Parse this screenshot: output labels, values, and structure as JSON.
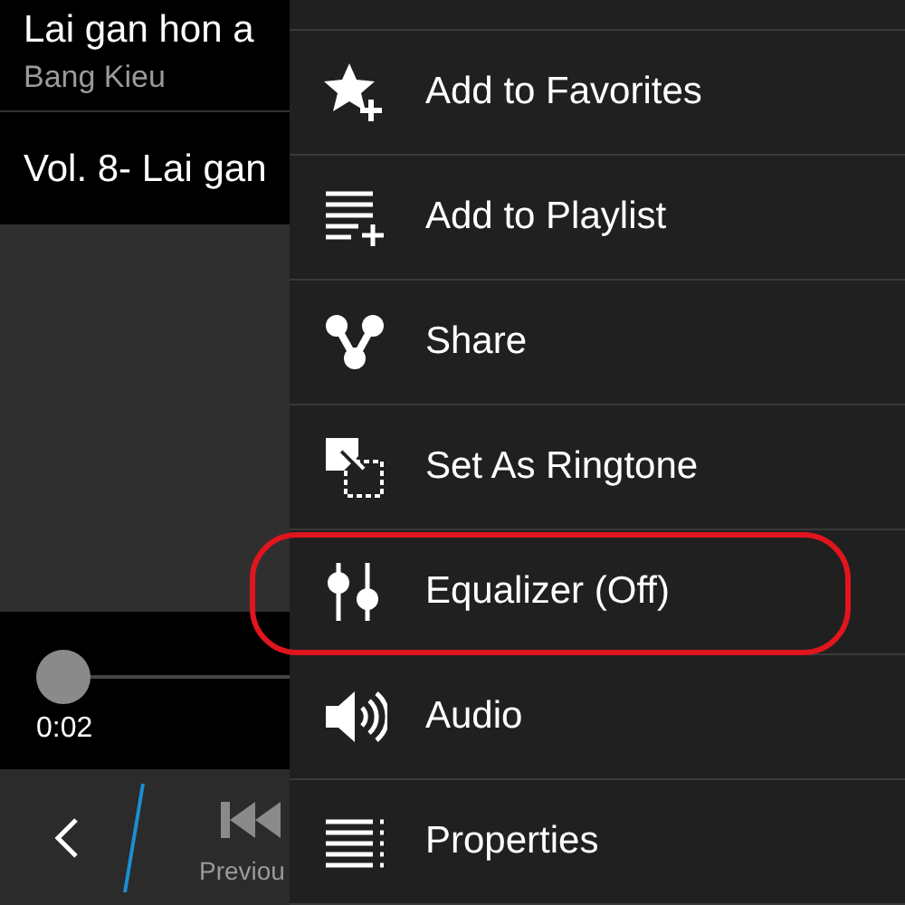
{
  "now_playing": {
    "title": "Lai gan hon a",
    "artist": "Bang Kieu",
    "album": "Vol. 8- Lai gan"
  },
  "progress": {
    "level": 0,
    "elapsed": "0:02"
  },
  "action_bar": {
    "previous_label": "Previou"
  },
  "menu": {
    "items": [
      {
        "kind": "favorite",
        "label": "Add to Favorites",
        "highlighted": false
      },
      {
        "kind": "playlist",
        "label": "Add to Playlist",
        "highlighted": false
      },
      {
        "kind": "share",
        "label": "Share",
        "highlighted": false
      },
      {
        "kind": "ringtone",
        "label": "Set As Ringtone",
        "highlighted": false
      },
      {
        "kind": "equalizer",
        "label": "Equalizer (Off)",
        "highlighted": true
      },
      {
        "kind": "audio",
        "label": "Audio",
        "highlighted": false
      },
      {
        "kind": "properties",
        "label": "Properties",
        "highlighted": false
      }
    ]
  }
}
